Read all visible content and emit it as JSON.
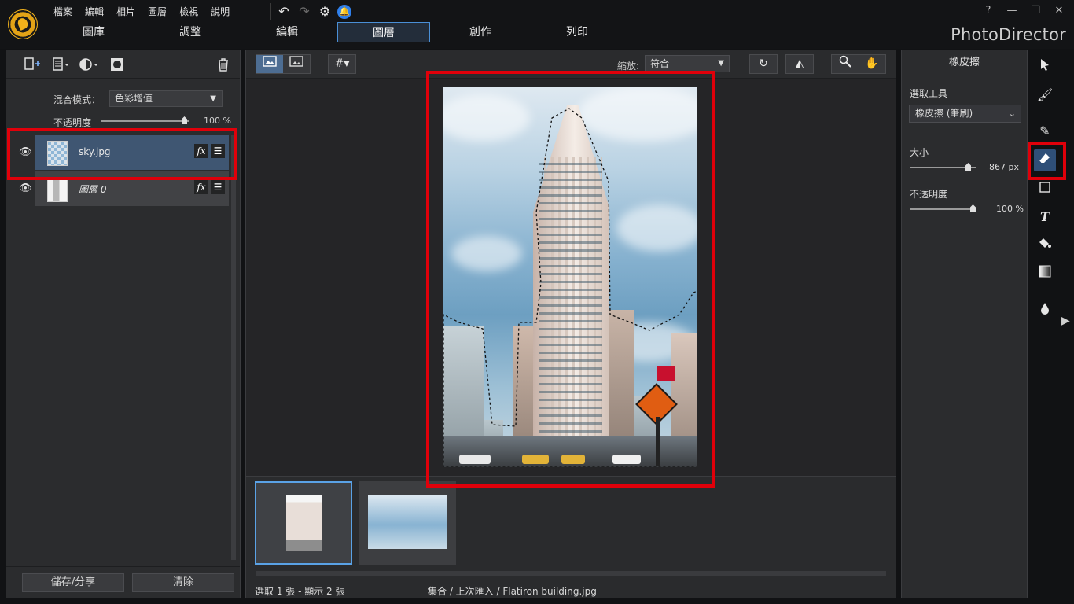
{
  "menu": [
    "檔案",
    "編輯",
    "相片",
    "圖層",
    "檢視",
    "說明"
  ],
  "quick_actions": {
    "undo": "↶",
    "redo": "↷",
    "settings": "⚙",
    "notification": "🔔"
  },
  "tabs": [
    {
      "label": "圖庫",
      "active": false
    },
    {
      "label": "調整",
      "active": false
    },
    {
      "label": "編輯",
      "active": false
    },
    {
      "label": "圖層",
      "active": true
    },
    {
      "label": "創作",
      "active": false
    },
    {
      "label": "列印",
      "active": false
    }
  ],
  "window_controls": {
    "help": "?",
    "minimize": "—",
    "restore": "❐",
    "close": "✕"
  },
  "brand": "PhotoDirector",
  "left_panel": {
    "blend_label": "混合模式：",
    "blend_value": "色彩增值",
    "opacity_label": "不透明度",
    "opacity_value": "100 %",
    "layers": [
      {
        "name": "sky.jpg",
        "visible": true,
        "selected": true
      },
      {
        "name": "圖層 0",
        "visible": true,
        "selected": false
      }
    ],
    "save_share_label": "儲存/分享",
    "clear_label": "清除"
  },
  "view": {
    "zoom_label": "縮放:",
    "zoom_value": "符合"
  },
  "status": {
    "count": "選取 1 張 - 顯示 2 張",
    "path": "集合 / 上次匯入 / Flatiron building.jpg"
  },
  "right_panel": {
    "title": "橡皮擦",
    "select_tool_label": "選取工具",
    "select_tool_value": "橡皮擦 (筆刷)",
    "size_label": "大小",
    "size_value": "867 px",
    "opacity_label": "不透明度",
    "opacity_value": "100 %"
  },
  "colors": {
    "accent": "#4a8fd6",
    "highlight": "#e0000a",
    "selected_layer": "#3f5672"
  }
}
